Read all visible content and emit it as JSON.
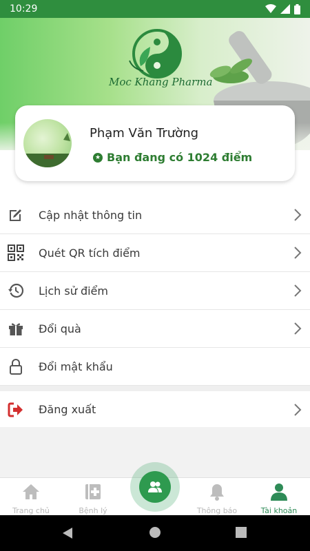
{
  "status_bar": {
    "time": "10:29"
  },
  "banner": {
    "brand": "Moc Khang Pharma"
  },
  "profile": {
    "name": "Phạm Văn Trường",
    "points_text": "Bạn đang có 1024 điểm"
  },
  "menu": {
    "items": [
      {
        "label": "Cập nhật thông tin",
        "icon": "edit-icon"
      },
      {
        "label": "Quét QR tích điểm",
        "icon": "qr-code-icon"
      },
      {
        "label": "Lịch sử  điểm",
        "icon": "history-icon"
      },
      {
        "label": "Đổi quà",
        "icon": "gift-icon"
      },
      {
        "label": "Đổi mật khẩu",
        "icon": "lock-icon"
      }
    ],
    "logout": {
      "label": "Đăng xuất",
      "icon": "logout-icon"
    }
  },
  "bottom_nav": {
    "items": [
      {
        "label": "Trang chủ",
        "icon": "home-icon"
      },
      {
        "label": "Bệnh lý",
        "icon": "medical-book-icon"
      },
      {
        "label": "Thông báo",
        "icon": "bell-icon"
      },
      {
        "label": "Tài khoản",
        "icon": "user-icon"
      }
    ],
    "active": "Tài khoản"
  },
  "colors": {
    "accent": "#2e9a4f",
    "status_bar": "#2f8e3e",
    "logout": "#d32f2f"
  }
}
